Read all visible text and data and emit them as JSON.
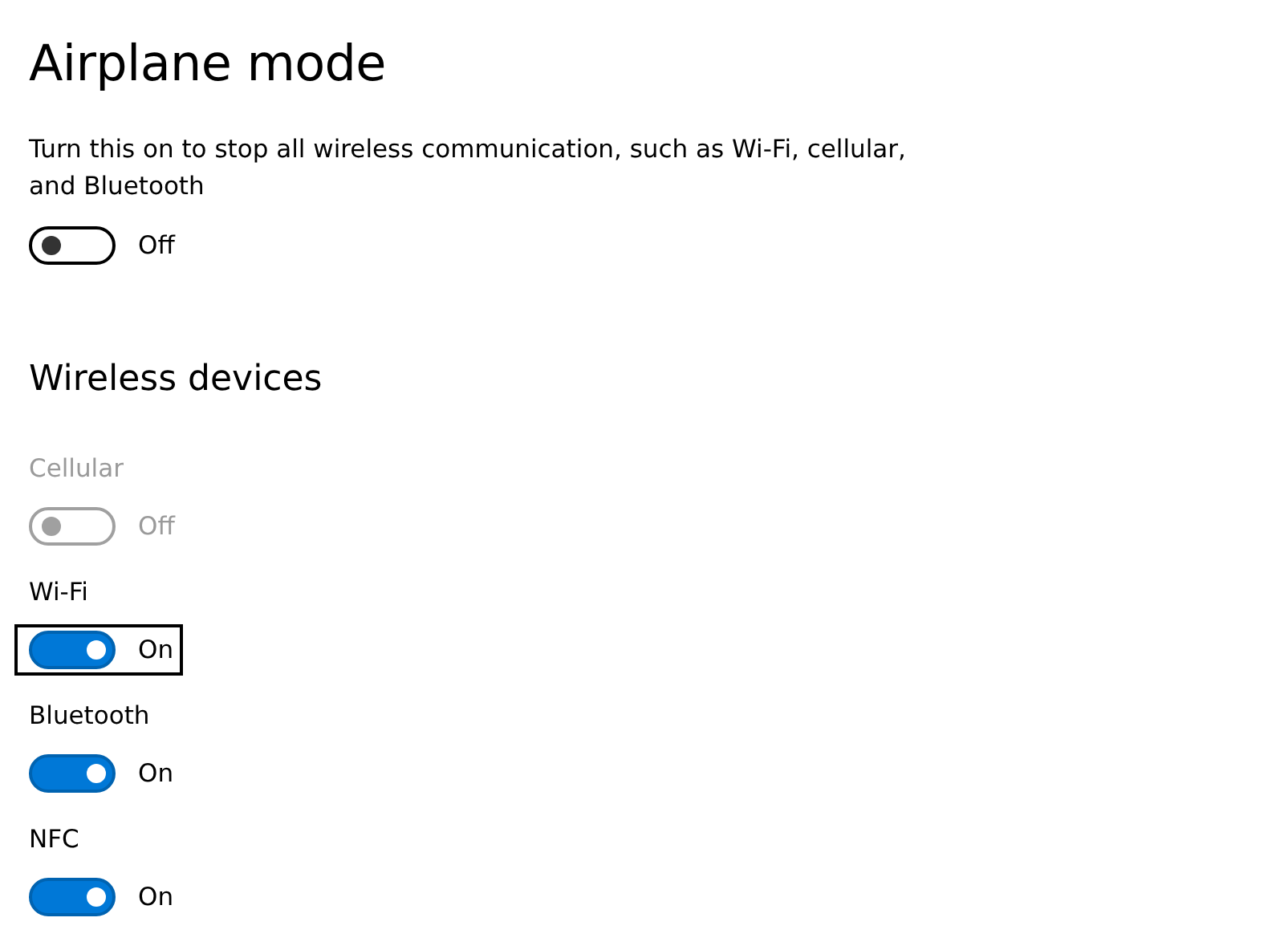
{
  "title": "Airplane mode",
  "description": "Turn this on to stop all wireless communication, such as Wi-Fi, cellular, and Bluetooth",
  "airplane_toggle": {
    "on": false,
    "state_label": "Off"
  },
  "section_title": "Wireless devices",
  "devices": [
    {
      "label": "Cellular",
      "on": false,
      "disabled": true,
      "focused": false,
      "state_label": "Off"
    },
    {
      "label": "Wi-Fi",
      "on": true,
      "disabled": false,
      "focused": true,
      "state_label": "On"
    },
    {
      "label": "Bluetooth",
      "on": true,
      "disabled": false,
      "focused": false,
      "state_label": "On"
    },
    {
      "label": "NFC",
      "on": true,
      "disabled": false,
      "focused": false,
      "state_label": "On"
    }
  ]
}
